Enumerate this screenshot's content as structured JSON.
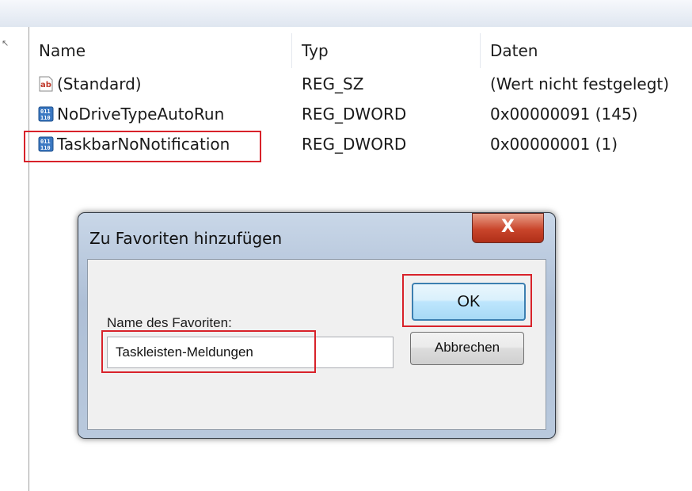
{
  "columns": {
    "name": "Name",
    "typ": "Typ",
    "daten": "Daten"
  },
  "rows": [
    {
      "icon": "string-value-icon",
      "name": "(Standard)",
      "typ": "REG_SZ",
      "daten": "(Wert nicht festgelegt)"
    },
    {
      "icon": "binary-value-icon",
      "name": "NoDriveTypeAutoRun",
      "typ": "REG_DWORD",
      "daten": "0x00000091 (145)"
    },
    {
      "icon": "binary-value-icon",
      "name": "TaskbarNoNotification",
      "typ": "REG_DWORD",
      "daten": "0x00000001 (1)",
      "selected": true
    }
  ],
  "dialog": {
    "title": "Zu Favoriten hinzufügen",
    "close_label": "X",
    "field_label": "Name des Favoriten:",
    "field_value": "Taskleisten-Meldungen",
    "ok_label": "OK",
    "cancel_label": "Abbrechen"
  },
  "highlight_color": "#d8222a"
}
